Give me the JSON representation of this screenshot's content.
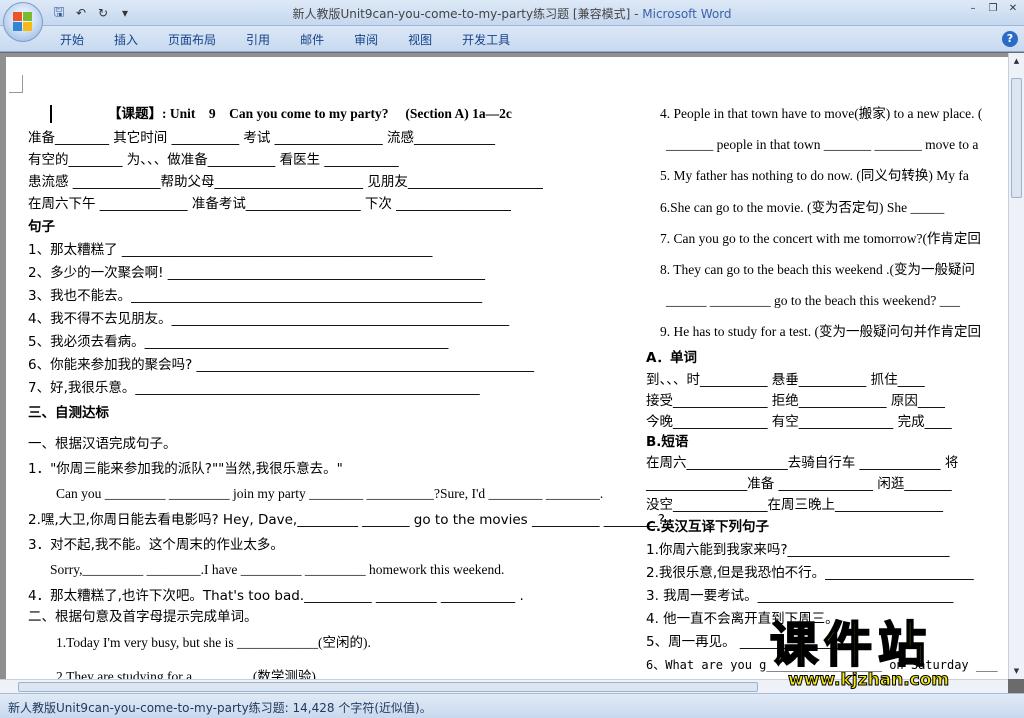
{
  "window": {
    "title": "新人教版Unit9can-you-come-to-my-party练习题 [兼容模式] - ",
    "app": "Microsoft Word"
  },
  "ribbon": {
    "tabs": [
      "开始",
      "插入",
      "页面布局",
      "引用",
      "邮件",
      "审阅",
      "视图",
      "开发工具"
    ]
  },
  "left_lines": [
    "【课题】: Unit　9　Can you come to my party?　 (Section A) 1a—2c",
    "准备________  其它时间 __________     考试 ________________    流感____________",
    "有空的________              为、、、做准备__________           看医生  ___________",
    "患流感 _____________帮助父母______________________    见朋友____________________",
    "在周六下午 _____________      准备考试_________________    下次   _________________",
    "句子",
    "1、那太糟糕了 ______________________________________________",
    "2、多少的一次聚会啊! _______________________________________________",
    "3、我也不能去。____________________________________________________",
    "4、我不得不去见朋友。__________________________________________________",
    "5、我必须去看病。_____________________________________________",
    "6、你能来参加我的聚会吗? __________________________________________________",
    "7、好,我很乐意。___________________________________________________",
    "三、自测达标",
    "一、根据汉语完成句子。",
    "1．\"你周三能来参加我的派队?\"\"当然,我很乐意去。\"",
    "Can you _________ _________ join my party ________ __________?Sure, I'd ________ ________.",
    "2.嘿,大卫,你周日能去看电影吗? Hey, Dave,_________ _______ go to the movies __________ ________?",
    "3．对不起,我不能。这个周末的作业太多。",
    "Sorry,_________ ________.I have _________ _________ homework this weekend.",
    "4．那太糟糕了,也许下次吧。That's too bad.__________ _________ ___________ .",
    "二、根据句意及首字母提示完成单词。",
    "1.Today I'm very busy, but she is ____________(空闲的).",
    "2.They are studying for a ________                            (数学测验)."
  ],
  "right_lines": [
    "4. People in that town have to move(搬家) to a new place. (",
    "_______ people in that town _______ _______ move to a",
    "5. My father has nothing to do now. (同义句转换)      My fa",
    "6.She can go to the movie. (变为否定句)          She _____",
    "7. Can you go to the concert with me tomorrow?(作肯定回",
    "8. They can go to the beach  this weekend  .(变为一般疑问",
    "______    _________ go to the beach this weekend?  ___",
    "9. He has to study for a test. (变为一般疑问句并作肯定回",
    "A．单词",
    "到、、、时__________        悬垂__________        抓住____",
    "接受______________        拒绝_____________      原因____",
    "今晚______________        有空______________     完成____",
    "B.短语",
    "在周六_______________去骑自行车 ____________  将",
    "_______________准备 ______________    闲逛_______",
    "没空______________在周三晚上________________",
    "C.英汉互译下列句子",
    "1.你周六能到我家来吗?________________________",
    "2.我很乐意,但是我恐怕不行。______________________",
    "3. 我周一要考试。_____________________________",
    "4. 他一直不会离开直到下周三。",
    "5、周一再见。 ___________________",
    "6、What are you g________________ on Saturday ___"
  ],
  "status": {
    "text": "新人教版Unit9can-you-come-to-my-party练习题: 14,428 个字符(近似值)。"
  },
  "watermark": {
    "title": "课件站",
    "url": "www.kjzhan.com"
  },
  "colors": {
    "title_accent": "#3b62a8",
    "ribbon_text": "#15428b",
    "watermark_fill": "#f4e90f"
  }
}
